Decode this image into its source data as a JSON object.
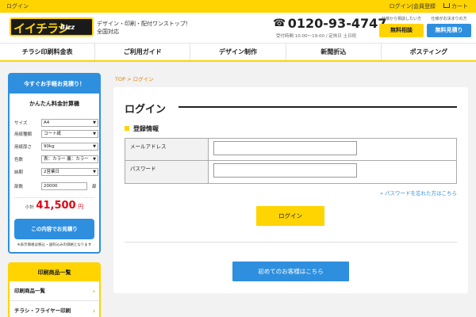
{
  "topbar": {
    "login": "ログイン",
    "member": "ログイン|会員登録",
    "cart": "カート"
  },
  "header": {
    "logo_main": "イイチラシ",
    "logo_sub": "Bizz",
    "tagline_1": "デザイン・印刷・配付ワンストップ！",
    "tagline_2": "全国対応",
    "phone": "0120-93-4747",
    "hours": "受付時間 10:00〜19:00 / 定休日 土日祝",
    "cta_consult_caption": "仕様から相談したい方",
    "cta_consult": "無料相談",
    "cta_estimate_caption": "仕様がお決まりの方",
    "cta_estimate": "無料見積り"
  },
  "nav": [
    "チラシ印刷料金表",
    "ご利用ガイド",
    "デザイン制作",
    "新聞折込",
    "ポスティング"
  ],
  "sidebar": {
    "calc_header": "今すぐお手軽お見積り！",
    "calc_title": "かんたん料金計算機",
    "rows": [
      {
        "label": "サイズ",
        "value": "A4"
      },
      {
        "label": "用紙種類",
        "value": "コート紙"
      },
      {
        "label": "用紙厚さ",
        "value": "90kg"
      },
      {
        "label": "色数",
        "value": "表：カラー 裏：カラー"
      },
      {
        "label": "納期",
        "value": "2営業日"
      }
    ],
    "qty_label": "部数",
    "qty_value": "20000",
    "qty_unit": "部",
    "subtotal_label": "小計",
    "subtotal_value": "41,500",
    "subtotal_unit": "円",
    "estimate_button": "この内容でお見積り",
    "note": "※表示価格は税込・送料込みの価格となります",
    "products_header": "印刷商品一覧",
    "products": [
      "印刷商品一覧",
      "チラシ・フライヤー印刷"
    ]
  },
  "breadcrumb": {
    "top": "TOP",
    "sep": " > ",
    "current": "ログイン"
  },
  "main": {
    "title": "ログイン",
    "section": "登録情報",
    "email_label": "メールアドレス",
    "password_label": "パスワード",
    "forgot": "» パスワードを忘れた方はこちら",
    "login_button": "ログイン",
    "new_customer_button": "初めてのお客様はこちら"
  },
  "colors": {
    "brand_yellow": "#ffd400",
    "brand_blue": "#2f8fdf",
    "price_red": "#e60012"
  }
}
